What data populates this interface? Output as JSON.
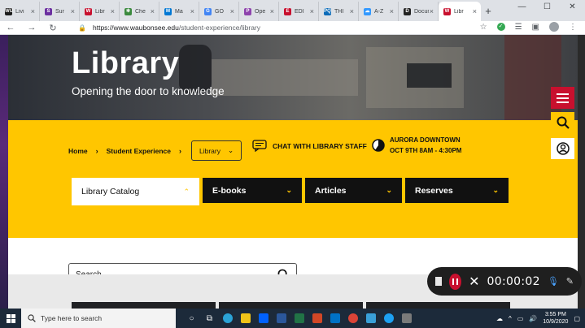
{
  "browser": {
    "tabs": [
      {
        "label": "Livi",
        "icon": "wu-icon",
        "color": "#1c1c1c",
        "glyph": "WU"
      },
      {
        "label": "Sur",
        "icon": "survey-icon",
        "color": "#6b2fa0",
        "glyph": "S"
      },
      {
        "label": "Libr",
        "icon": "library-icon",
        "color": "#c8102e",
        "glyph": "W"
      },
      {
        "label": "Che",
        "icon": "check-icon",
        "color": "#3b8a3e",
        "glyph": "✻"
      },
      {
        "label": "Ma",
        "icon": "mail-icon",
        "color": "#0078d4",
        "glyph": "M"
      },
      {
        "label": "GO",
        "icon": "google-icon",
        "color": "#4285f4",
        "glyph": "G"
      },
      {
        "label": "Ope",
        "icon": "open-icon",
        "color": "#8e44ad",
        "glyph": "P"
      },
      {
        "label": "EDI",
        "icon": "edit-icon",
        "color": "#c8102e",
        "glyph": "E"
      },
      {
        "label": "THI",
        "icon": "pq-icon",
        "color": "#0b6bb8",
        "glyph": "PQ"
      },
      {
        "label": "A-Z",
        "icon": "cloud-icon",
        "color": "#3399ff",
        "glyph": "☁"
      },
      {
        "label": "Docum",
        "icon": "document-icon",
        "color": "#222222",
        "glyph": "D"
      },
      {
        "label": "Libr",
        "icon": "library-active-icon",
        "color": "#c8102e",
        "glyph": "W",
        "active": true
      }
    ],
    "url_host": "https://www.waubonsee.edu",
    "url_path": "/student-experience/library"
  },
  "hero": {
    "title": "Library",
    "subtitle": "Opening the door to knowledge"
  },
  "breadcrumb": {
    "home": "Home",
    "section": "Student Experience",
    "current": "Library"
  },
  "chat": {
    "label": "CHAT WITH LIBRARY STAFF"
  },
  "event": {
    "location": "AURORA DOWNTOWN",
    "hours": "OCT 9TH 8AM - 4:30PM"
  },
  "tabs": [
    {
      "label": "Library Catalog",
      "active": true
    },
    {
      "label": "E-books",
      "active": false
    },
    {
      "label": "Articles",
      "active": false
    },
    {
      "label": "Reserves",
      "active": false
    }
  ],
  "search": {
    "placeholder": "Search"
  },
  "recorder": {
    "time": "00:00:02"
  },
  "taskbar": {
    "search_placeholder": "Type here to search",
    "time": "3:55 PM",
    "date": "10/9/2020"
  },
  "colors": {
    "brand_yellow": "#ffc600",
    "brand_red": "#c8102e",
    "dark": "#111111"
  }
}
